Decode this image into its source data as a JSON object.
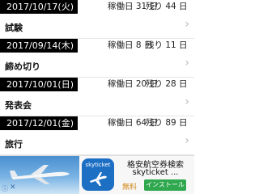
{
  "entries": [
    {
      "date": "2017/10/17(火)",
      "workdays": "稼働日 31 日",
      "remaining": "残り 44 日",
      "title": "試験"
    },
    {
      "date": "2017/09/14(木)",
      "workdays": "稼働日 8 日",
      "remaining": "残り 11 日",
      "title": "締め切り"
    },
    {
      "date": "2017/10/01(日)",
      "workdays": "稼働日 20 日",
      "remaining": "残り 28 日",
      "title": "発表会"
    },
    {
      "date": "2017/12/01(金)",
      "workdays": "稼働日 64 日",
      "remaining": "残り 89 日",
      "title": "旅行"
    }
  ],
  "icons": {
    "chevron": "chevron-right-icon",
    "ad_info": "info-icon",
    "ad_close": "close-icon",
    "ad_app": "airplane-icon"
  },
  "ad": {
    "app_name": "skyticket",
    "title": "格安航空券検索",
    "subtitle": "skyticket ...",
    "price": "無料",
    "install_label": "インストール"
  },
  "colors": {
    "date_bg": "#000000",
    "install_button": "#2fa84f",
    "app_icon_bg": "#1d6fc4"
  }
}
